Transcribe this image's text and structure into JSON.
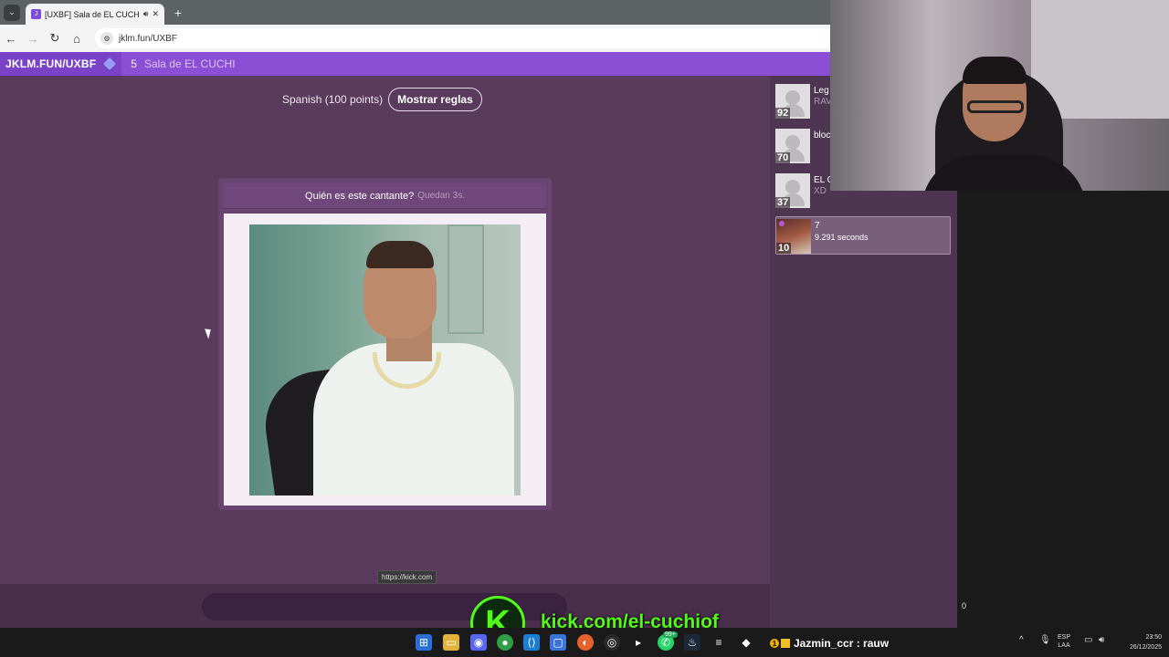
{
  "browser": {
    "tab_title": "[UXBF] Sala de EL CUCHI",
    "address": "jklm.fun/UXBF"
  },
  "site": {
    "brand": "JKLM.FUN/UXBF",
    "player_count": "5",
    "room_name": "Sala de EL CUCHI"
  },
  "game": {
    "language_label": "Spanish (100 points)",
    "rules_button": "Mostrar reglas",
    "question": "Quién es este cantante?",
    "timer": "Quedan 3s."
  },
  "status_url": "https://kick.com",
  "players": [
    {
      "name": "Leg",
      "sub": "RAV",
      "score": "92"
    },
    {
      "name": "bloc",
      "sub": "",
      "score": "70"
    },
    {
      "name": "EL C",
      "sub": "XD",
      "score": "37"
    },
    {
      "name": "7",
      "sub": "9.291 seconds",
      "score": "10"
    }
  ],
  "obs_marker": "0",
  "stream": {
    "logo_letter": "K",
    "url": "kick.com/el-cuchiof"
  },
  "taskbar": {
    "whatsapp_badge": "99+",
    "chat_message": "Jazmin_ccr : rauw",
    "chat_badge": "1",
    "lang_top": "ESP",
    "lang_bottom": "LAA",
    "time": "23:50",
    "date": "26/12/2025"
  }
}
